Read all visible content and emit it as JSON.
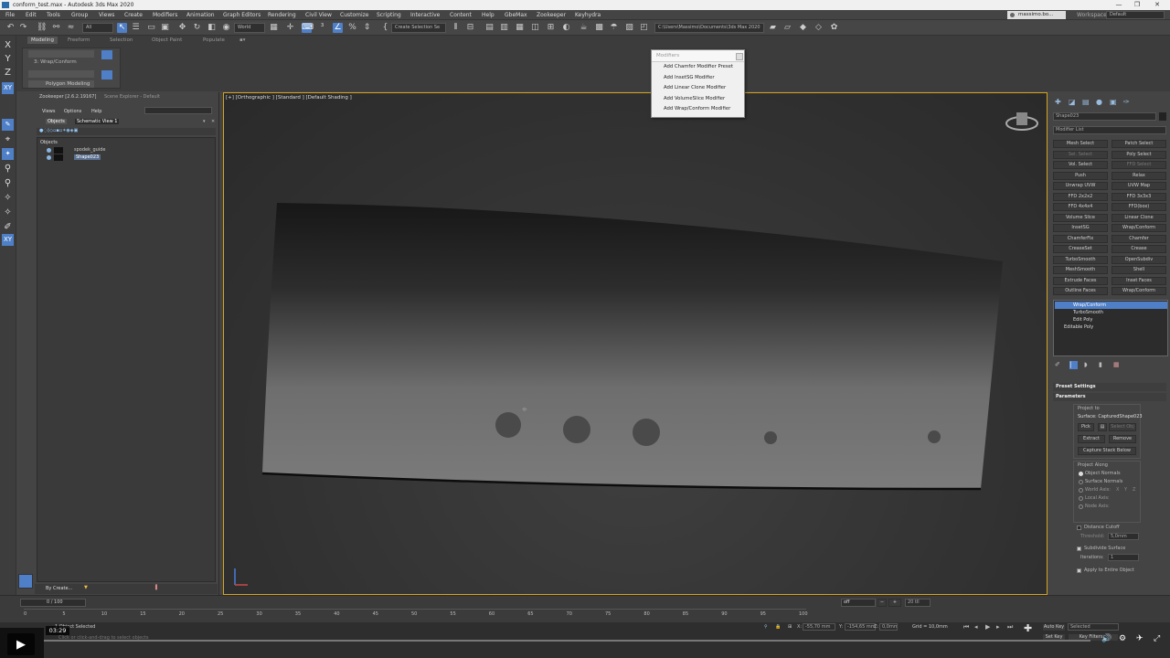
{
  "window": {
    "title": "conform_test.max - Autodesk 3ds Max 2020",
    "minimize": "—",
    "maximize": "❐",
    "close": "✕"
  },
  "menubar": [
    "File",
    "Edit",
    "Tools",
    "Group",
    "Views",
    "Create",
    "Modifiers",
    "Animation",
    "Graph Editors",
    "Rendering",
    "Civil View",
    "Customize",
    "Scripting",
    "Interactive",
    "Content",
    "Help",
    "GbeMax",
    "Zookeeper",
    "Keyhydra"
  ],
  "account": {
    "user": "massimo.bo...",
    "workspaces_label": "Workspaces:",
    "workspace": "Default"
  },
  "toolbar": {
    "selection_filter": "All",
    "coord": "World",
    "named_selection": "Create Selection Se",
    "project_path": "C:\\Users\\Massimo\\Documents\\3ds Max 2020"
  },
  "left_axes": [
    "X",
    "Y",
    "Z",
    "XY",
    "XY",
    "XY"
  ],
  "ribbon": {
    "tabs": [
      "Modeling",
      "Freeform",
      "Selection",
      "Object Paint",
      "Populate"
    ],
    "stack_label": "3: Wrap/Conform",
    "group_label": "Polygon Modeling"
  },
  "scene_explorer": {
    "tab_zookeeper": "Zookeeper [2.6.2.19167]",
    "tab_explorer": "Scene Explorer - Default",
    "menu": [
      "Views",
      "Options",
      "Help"
    ],
    "subtabs": [
      "Objects",
      "Schematic View 1"
    ],
    "root": "Objects",
    "items": [
      "spodek_guide",
      "Shape023"
    ],
    "footer_label": "By Create..."
  },
  "popup": {
    "title": "Modifiers",
    "items": [
      "Add Chamfer Modifier Preset",
      "Add InsetSG Modifier",
      "Add Linear Clone Modifier",
      "Add VolumeSlice Modifier",
      "Add Wrap/Conform Modifier"
    ]
  },
  "viewport": {
    "label": "[+] [Orthographic ] [Standard ] [Default Shading ]"
  },
  "command_panel": {
    "object_name": "Shape023",
    "modifier_list": "Modifier List",
    "buttons": [
      [
        "Mesh Select",
        "Patch Select"
      ],
      [
        "Sel. Select",
        "Poly Select"
      ],
      [
        "Vol. Select",
        "FFD Select"
      ],
      [
        "Push",
        "Relax"
      ],
      [
        "Unwrap UVW",
        "UVW Map"
      ],
      [
        "FFD 2x2x2",
        "FFD 3x3x3"
      ],
      [
        "FFD 4x4x4",
        "FFD(box)"
      ],
      [
        "Volume Slice",
        "Linear Clone"
      ],
      [
        "InsetSG",
        "Wrap/Conform"
      ],
      [
        "ChamferFix",
        "Chamfer"
      ],
      [
        "CreaseSet",
        "Crease"
      ],
      [
        "TurboSmooth",
        "OpenSubdiv"
      ],
      [
        "MeshSmooth",
        "Shell"
      ],
      [
        "Extrude Faces",
        "Inset Faces"
      ],
      [
        "Outline Faces",
        "Wrap/Conform"
      ]
    ],
    "stack": [
      "Wrap/Conform",
      "TurboSmooth",
      "Edit Poly",
      "Editable Poly"
    ],
    "rollouts": {
      "preset": "Preset Settings",
      "params": "Parameters"
    },
    "project_to": "Project to",
    "surface": "Surface: CapturedShape023",
    "pick": "Pick",
    "select_obj": "Select Obj",
    "extract": "Extract",
    "remove": "Remove",
    "capture": "Capture Stack Below",
    "project_along": "Project Along",
    "along_opts": [
      "Object Normals",
      "Surface Normals",
      "World Axis:",
      "Local Axis:",
      "Node Axis:"
    ],
    "xyz": [
      "X",
      "Y",
      "Z"
    ],
    "distance_cutoff": "Distance Cutoff",
    "threshold_label": "Threshold:",
    "threshold": "5,0mm",
    "subdivide": "Subdivide Surface",
    "iterations_label": "Iterations:",
    "iterations": "1",
    "apply_entire": "Apply to Entire Object"
  },
  "timeline": {
    "frame": "0 / 100",
    "ticks": [
      "0",
      "5",
      "10",
      "15",
      "20",
      "25",
      "30",
      "35",
      "40",
      "45",
      "50",
      "55",
      "60",
      "65",
      "70",
      "75",
      "80",
      "85",
      "90",
      "95",
      "100"
    ]
  },
  "status": {
    "selected": "1 Object Selected",
    "hint": "Click or click-and-drag to select objects",
    "x_label": "X:",
    "y_label": "Y:",
    "z_label": "Z:",
    "x": "-55,70 mm",
    "y": "-154,65 mm",
    "z": "0,0mm",
    "grid": "Grid = 10,0mm",
    "autokey": "Auto Key",
    "selected_dd": "Selected",
    "setkey": "Set Key",
    "keyfilters": "Key Filters...",
    "off": "off",
    "fps": "20 tll"
  },
  "video": {
    "time": "03:29"
  }
}
